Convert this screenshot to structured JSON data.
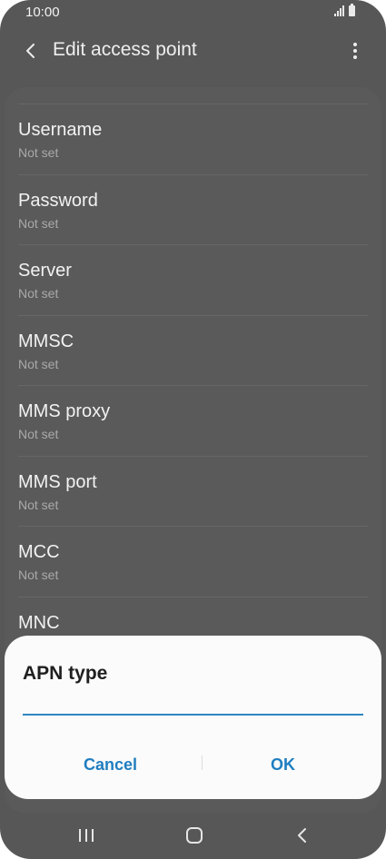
{
  "status_bar": {
    "time": "10:00"
  },
  "app_bar": {
    "title": "Edit access point"
  },
  "apn_fields": [
    {
      "label": "Username",
      "value": "Not set"
    },
    {
      "label": "Password",
      "value": "Not set"
    },
    {
      "label": "Server",
      "value": "Not set"
    },
    {
      "label": "MMSC",
      "value": "Not set"
    },
    {
      "label": "MMS proxy",
      "value": "Not set"
    },
    {
      "label": "MMS port",
      "value": "Not set"
    },
    {
      "label": "MCC",
      "value": "Not set"
    },
    {
      "label": "MNC",
      "value": ""
    }
  ],
  "dialog": {
    "title": "APN type",
    "input_value": "",
    "cancel_label": "Cancel",
    "ok_label": "OK"
  },
  "colors": {
    "accent": "#1f7ec0",
    "input_underline": "#2f86c1",
    "scrim_background": "#575757"
  },
  "icons": {
    "back": "back-arrow-icon",
    "more": "more-vertical-icon",
    "signal": "signal-icon",
    "battery": "battery-icon",
    "nav_recent": "recent-apps-icon",
    "nav_home": "home-icon",
    "nav_back": "back-icon"
  }
}
